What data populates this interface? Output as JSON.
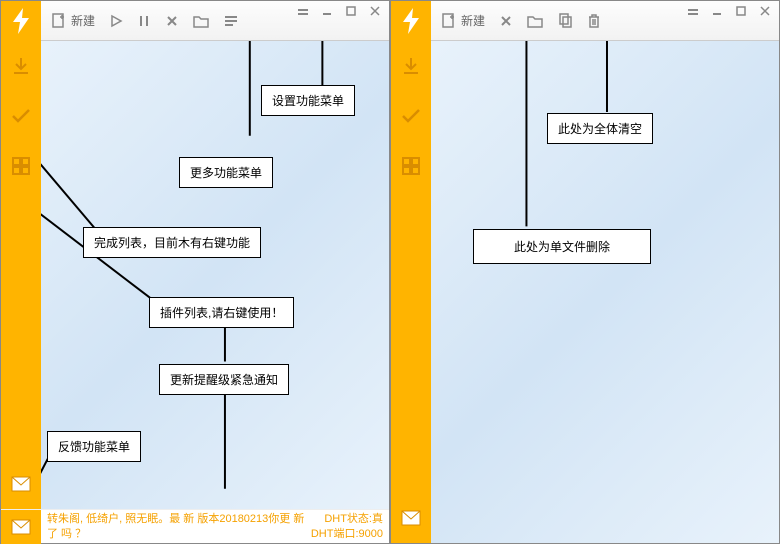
{
  "left": {
    "toolbar": {
      "new_label": "新建",
      "icons": [
        "new-doc",
        "play",
        "pause",
        "close",
        "folder",
        "more"
      ]
    },
    "windowControls": [
      "settings",
      "minimize",
      "maximize",
      "close"
    ],
    "sidebar": [
      "download",
      "check",
      "grid",
      "mail"
    ],
    "callouts": {
      "settings": "设置功能菜单",
      "more": "更多功能菜单",
      "completed": "完成列表，目前木有右键功能",
      "plugins": "插件列表,请右键使用！",
      "update": "更新提醒级紧急通知",
      "feedback": "反馈功能菜单"
    },
    "status": {
      "msg": "转朱阁, 低绮户, 照无眠。最 新 版本20180213你更 新 了 吗 ？",
      "dht_status_label": "DHT状态:",
      "dht_status_value": "真",
      "dht_port_label": "DHT端口:",
      "dht_port_value": "9000"
    }
  },
  "right": {
    "toolbar": {
      "new_label": "新建",
      "icons": [
        "new-doc",
        "close",
        "folder",
        "copy",
        "trash"
      ]
    },
    "windowControls": [
      "settings",
      "minimize",
      "maximize",
      "close"
    ],
    "sidebar": [
      "download",
      "check",
      "grid",
      "mail"
    ],
    "callouts": {
      "clear_all": "此处为全体清空",
      "delete_one": "此处为单文件删除"
    }
  },
  "colors": {
    "accent": "#ffb400",
    "stroke": "#000000"
  }
}
